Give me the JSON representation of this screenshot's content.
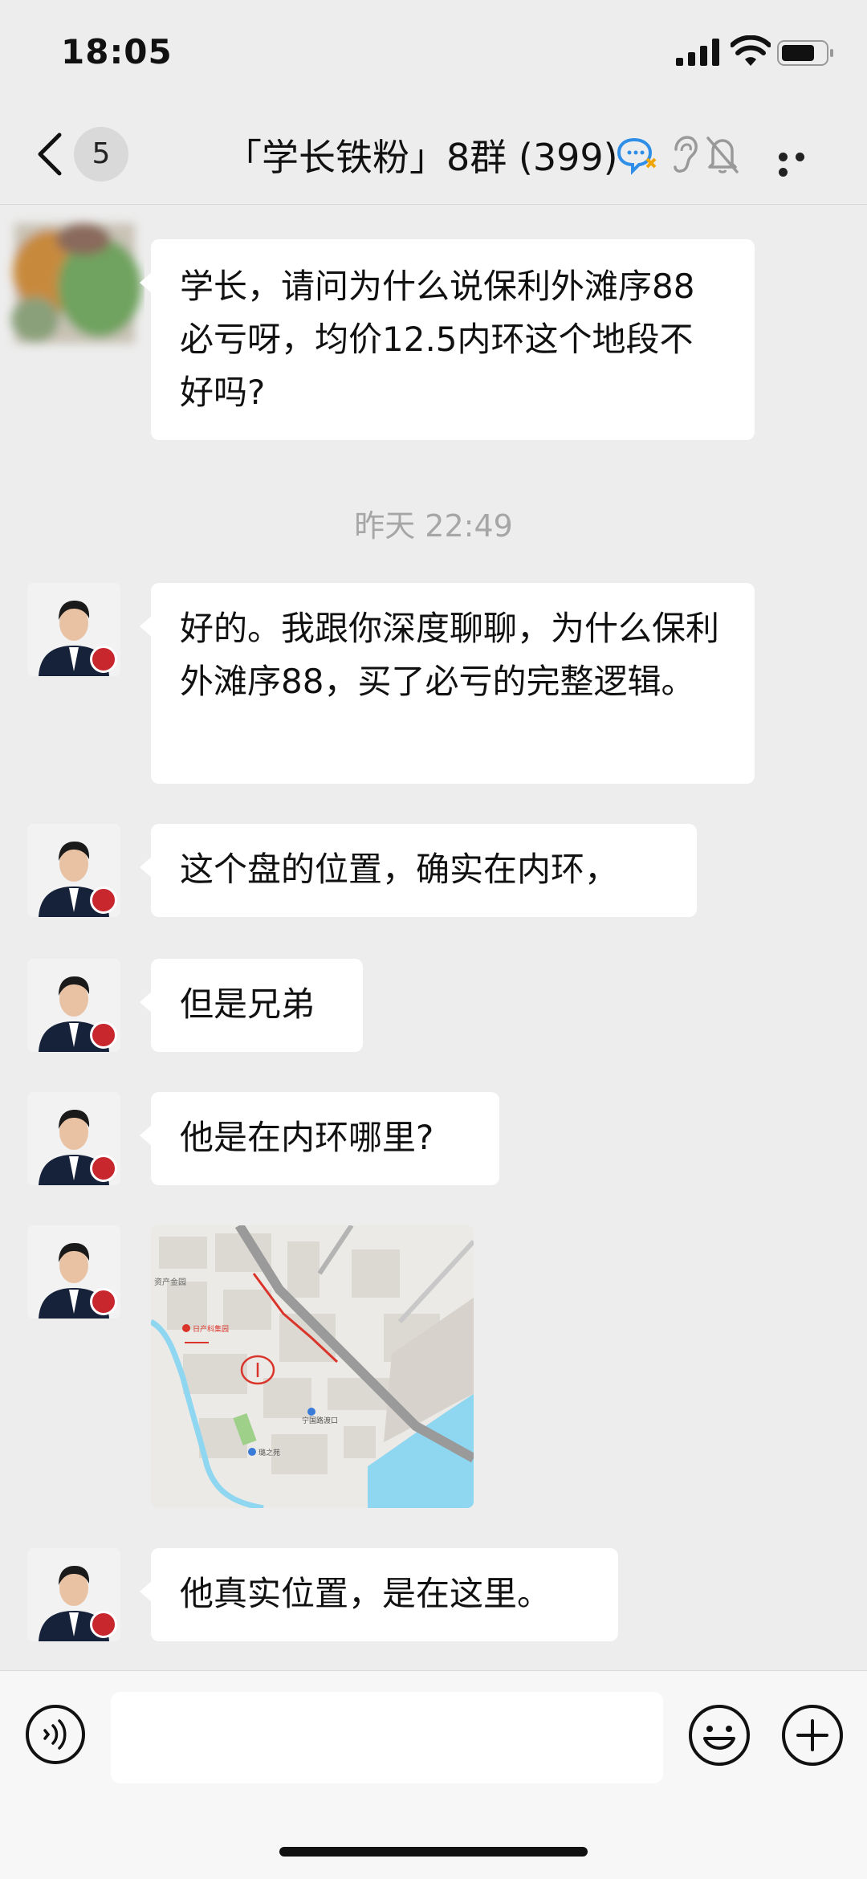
{
  "status": {
    "time": "18:05"
  },
  "header": {
    "unread_count": "5",
    "title": "「学长铁粉」8群 (399)"
  },
  "messages": [
    {
      "text": "学长，请问为什么说保利外滩序88必亏呀，均价12.5内环这个地段不好吗?"
    },
    {
      "text": "好的。我跟你深度聊聊，为什么保利外滩序88，买了必亏的完整逻辑。"
    },
    {
      "text": "这个盘的位置，确实在内环，"
    },
    {
      "text": "但是兄弟"
    },
    {
      "text": "他是在内环哪里?"
    },
    {
      "text": "他真实位置，是在这里。"
    }
  ],
  "timestamp": "昨天 22:49",
  "map": {
    "labels": [
      "资产金园",
      "日产科集园",
      "宁国路渡口",
      "璐之苑"
    ]
  },
  "colors": {
    "background": "#ededed",
    "bubble": "#ffffff",
    "accent_red": "#d9352b",
    "water": "#8fd6f0"
  }
}
